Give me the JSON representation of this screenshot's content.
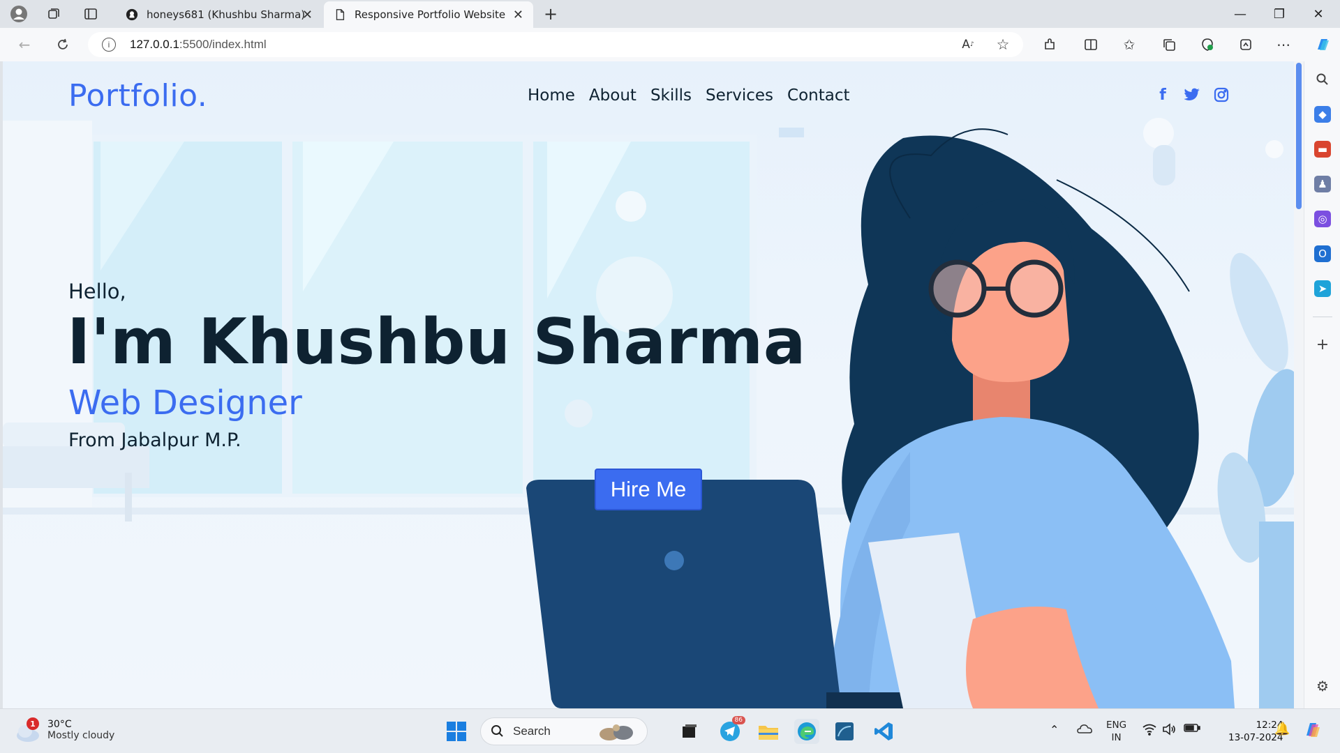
{
  "browser": {
    "tabs": [
      {
        "title": "honeys681 (Khushbu Sharma)",
        "active": false
      },
      {
        "title": "Responsive Portfolio Website",
        "active": true
      }
    ],
    "url_host": "127.0.0.1",
    "url_path": ":5500/index.html"
  },
  "site": {
    "logo": "Portfolio.",
    "nav": [
      "Home",
      "About",
      "Skills",
      "Services",
      "Contact"
    ],
    "social_icons": [
      "facebook-icon",
      "twitter-icon",
      "instagram-icon"
    ],
    "hero": {
      "greeting": "Hello,",
      "name": "I'm Khushbu Sharma",
      "role": "Web Designer",
      "location": "From Jabalpur M.P.",
      "cta": "Hire Me"
    }
  },
  "taskbar": {
    "weather_badge": "1",
    "temperature": "30°C",
    "condition": "Mostly cloudy",
    "search_placeholder": "Search",
    "telegram_badge": "86",
    "lang_line1": "ENG",
    "lang_line2": "IN",
    "time": "12:24",
    "date": "13-07-2024"
  },
  "colors": {
    "accent": "#3b6cf0",
    "text_dark": "#0e2231",
    "hair": "#0f3657",
    "skin": "#fca289",
    "sweater": "#8bbff5",
    "laptop": "#1a4776"
  }
}
